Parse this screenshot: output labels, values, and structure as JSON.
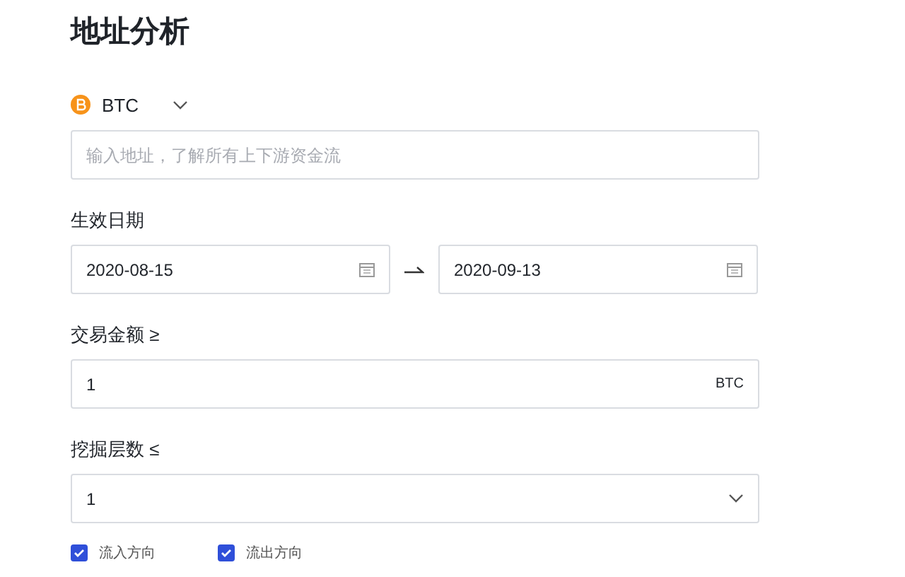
{
  "title": "地址分析",
  "coin": {
    "symbol": "BTC"
  },
  "address": {
    "placeholder": "输入地址，了解所有上下游资金流"
  },
  "date_label": "生效日期",
  "date_range": {
    "start": "2020-08-15",
    "end": "2020-09-13"
  },
  "amount": {
    "label": "交易金额 ≥",
    "value": "1",
    "unit": "BTC"
  },
  "depth": {
    "label": "挖掘层数 ≤",
    "value": "1"
  },
  "directions": [
    {
      "label": "流入方向",
      "checked": true
    },
    {
      "label": "流出方向",
      "checked": true
    }
  ]
}
